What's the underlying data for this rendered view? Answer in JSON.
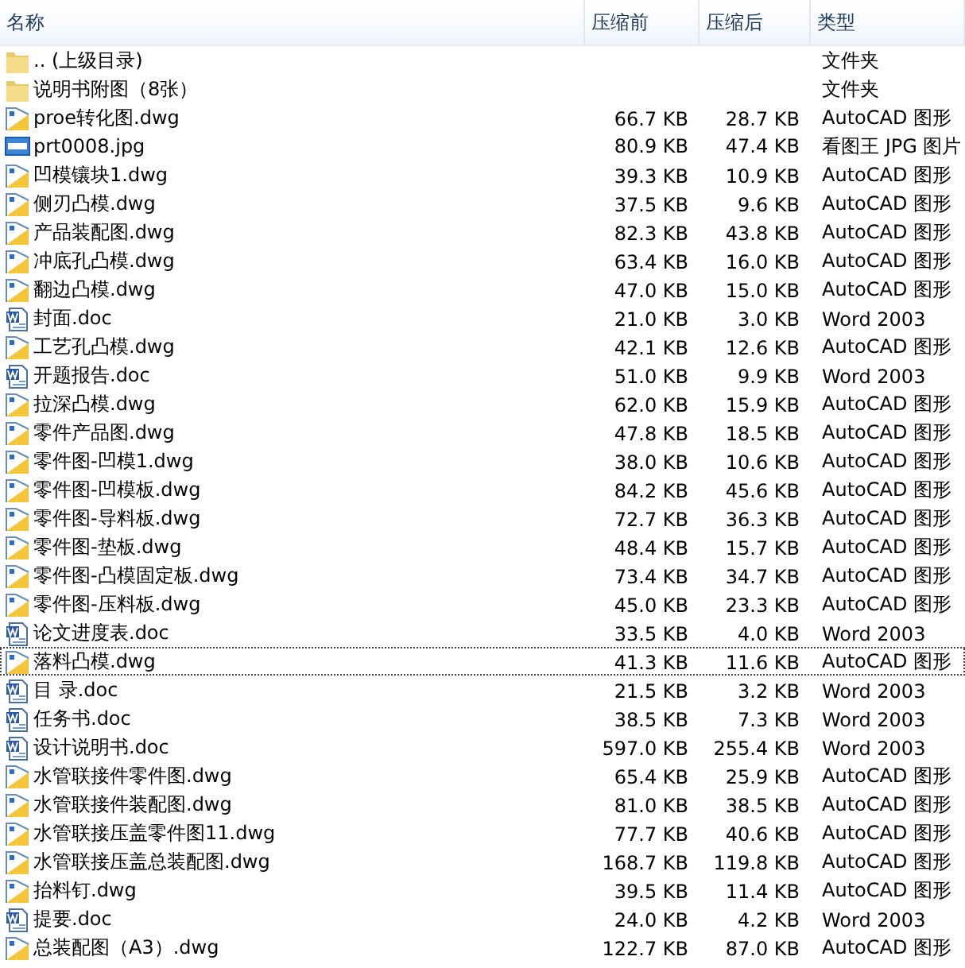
{
  "table": {
    "columns": [
      "名称",
      "压缩前",
      "压缩后",
      "类型"
    ],
    "rows": [
      {
        "kind": "folder",
        "name": ".. (上级目录)",
        "type": "文件夹",
        "focused": false
      },
      {
        "kind": "folder",
        "name": "说明书附图（8张）",
        "type": "文件夹",
        "focused": false
      },
      {
        "kind": "dwg",
        "name": "proe转化图.dwg",
        "size": "66.7 KB",
        "packed": "28.7 KB",
        "type": "AutoCAD 图形",
        "focused": false
      },
      {
        "kind": "jpg",
        "name": "prt0008.jpg",
        "size": "80.9 KB",
        "packed": "47.4 KB",
        "type": "看图王 JPG 图片",
        "focused": false
      },
      {
        "kind": "dwg",
        "name": "凹模镶块1.dwg",
        "size": "39.3 KB",
        "packed": "10.9 KB",
        "type": "AutoCAD 图形",
        "focused": false
      },
      {
        "kind": "dwg",
        "name": "侧刃凸模.dwg",
        "size": "37.5 KB",
        "packed": "9.6 KB",
        "type": "AutoCAD 图形",
        "focused": false
      },
      {
        "kind": "dwg",
        "name": "产品装配图.dwg",
        "size": "82.3 KB",
        "packed": "43.8 KB",
        "type": "AutoCAD 图形",
        "focused": false
      },
      {
        "kind": "dwg",
        "name": "冲底孔凸模.dwg",
        "size": "63.4 KB",
        "packed": "16.0 KB",
        "type": "AutoCAD 图形",
        "focused": false
      },
      {
        "kind": "dwg",
        "name": "翻边凸模.dwg",
        "size": "47.0 KB",
        "packed": "15.0 KB",
        "type": "AutoCAD 图形",
        "focused": false
      },
      {
        "kind": "doc",
        "name": "封面.doc",
        "size": "21.0 KB",
        "packed": "3.0 KB",
        "type": "Word 2003",
        "focused": false
      },
      {
        "kind": "dwg",
        "name": "工艺孔凸模.dwg",
        "size": "42.1 KB",
        "packed": "12.6 KB",
        "type": "AutoCAD 图形",
        "focused": false
      },
      {
        "kind": "doc",
        "name": "开题报告.doc",
        "size": "51.0 KB",
        "packed": "9.9 KB",
        "type": "Word 2003",
        "focused": false
      },
      {
        "kind": "dwg",
        "name": "拉深凸模.dwg",
        "size": "62.0 KB",
        "packed": "15.9 KB",
        "type": "AutoCAD 图形",
        "focused": false
      },
      {
        "kind": "dwg",
        "name": "零件产品图.dwg",
        "size": "47.8 KB",
        "packed": "18.5 KB",
        "type": "AutoCAD 图形",
        "focused": false
      },
      {
        "kind": "dwg",
        "name": "零件图-凹模1.dwg",
        "size": "38.0 KB",
        "packed": "10.6 KB",
        "type": "AutoCAD 图形",
        "focused": false
      },
      {
        "kind": "dwg",
        "name": "零件图-凹模板.dwg",
        "size": "84.2 KB",
        "packed": "45.6 KB",
        "type": "AutoCAD 图形",
        "focused": false
      },
      {
        "kind": "dwg",
        "name": "零件图-导料板.dwg",
        "size": "72.7 KB",
        "packed": "36.3 KB",
        "type": "AutoCAD 图形",
        "focused": false
      },
      {
        "kind": "dwg",
        "name": "零件图-垫板.dwg",
        "size": "48.4 KB",
        "packed": "15.7 KB",
        "type": "AutoCAD 图形",
        "focused": false
      },
      {
        "kind": "dwg",
        "name": "零件图-凸模固定板.dwg",
        "size": "73.4 KB",
        "packed": "34.7 KB",
        "type": "AutoCAD 图形",
        "focused": false
      },
      {
        "kind": "dwg",
        "name": "零件图-压料板.dwg",
        "size": "45.0 KB",
        "packed": "23.3 KB",
        "type": "AutoCAD 图形",
        "focused": false
      },
      {
        "kind": "doc",
        "name": "论文进度表.doc",
        "size": "33.5 KB",
        "packed": "4.0 KB",
        "type": "Word 2003",
        "focused": false
      },
      {
        "kind": "dwg",
        "name": "落料凸模.dwg",
        "size": "41.3 KB",
        "packed": "11.6 KB",
        "type": "AutoCAD 图形",
        "focused": true
      },
      {
        "kind": "doc",
        "name": "目 录.doc",
        "size": "21.5 KB",
        "packed": "3.2 KB",
        "type": "Word 2003",
        "focused": false
      },
      {
        "kind": "doc",
        "name": "任务书.doc",
        "size": "38.5 KB",
        "packed": "7.3 KB",
        "type": "Word 2003",
        "focused": false
      },
      {
        "kind": "doc",
        "name": "设计说明书.doc",
        "size": "597.0 KB",
        "packed": "255.4 KB",
        "type": "Word 2003",
        "focused": false
      },
      {
        "kind": "dwg",
        "name": "水管联接件零件图.dwg",
        "size": "65.4 KB",
        "packed": "25.9 KB",
        "type": "AutoCAD 图形",
        "focused": false
      },
      {
        "kind": "dwg",
        "name": "水管联接件装配图.dwg",
        "size": "81.0 KB",
        "packed": "38.5 KB",
        "type": "AutoCAD 图形",
        "focused": false
      },
      {
        "kind": "dwg",
        "name": "水管联接压盖零件图11.dwg",
        "size": "77.7 KB",
        "packed": "40.6 KB",
        "type": "AutoCAD 图形",
        "focused": false
      },
      {
        "kind": "dwg",
        "name": "水管联接压盖总装配图.dwg",
        "size": "168.7 KB",
        "packed": "119.8 KB",
        "type": "AutoCAD 图形",
        "focused": false
      },
      {
        "kind": "dwg",
        "name": "抬料钉.dwg",
        "size": "39.5 KB",
        "packed": "11.4 KB",
        "type": "AutoCAD 图形",
        "focused": false
      },
      {
        "kind": "doc",
        "name": "提要.doc",
        "size": "24.0 KB",
        "packed": "4.2 KB",
        "type": "Word 2003",
        "focused": false
      },
      {
        "kind": "dwg",
        "name": "总装配图（A3）.dwg",
        "size": "122.7 KB",
        "packed": "87.0 KB",
        "type": "AutoCAD 图形",
        "focused": false
      }
    ]
  }
}
